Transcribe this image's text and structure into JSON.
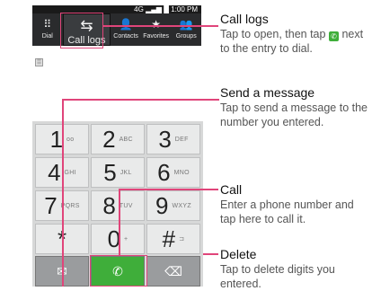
{
  "status": {
    "time": "1:00 PM",
    "signal_text": "4G"
  },
  "tabs": [
    {
      "label": "Dial",
      "icon": "dialpad-icon",
      "glyph": "⠿"
    },
    {
      "label": "Call logs",
      "icon": "call-logs-icon",
      "glyph": "⇆",
      "active": true
    },
    {
      "label": "Contacts",
      "icon": "contacts-icon",
      "glyph": "👤"
    },
    {
      "label": "Favorites",
      "icon": "star-icon",
      "glyph": "★"
    },
    {
      "label": "Groups",
      "icon": "groups-icon",
      "glyph": "👥"
    }
  ],
  "keys": [
    {
      "digit": "1",
      "sub": "oo"
    },
    {
      "digit": "2",
      "sub": "ABC"
    },
    {
      "digit": "3",
      "sub": "DEF"
    },
    {
      "digit": "4",
      "sub": "GHI"
    },
    {
      "digit": "5",
      "sub": "JKL"
    },
    {
      "digit": "6",
      "sub": "MNO"
    },
    {
      "digit": "7",
      "sub": "PQRS"
    },
    {
      "digit": "8",
      "sub": "TUV"
    },
    {
      "digit": "9",
      "sub": "WXYZ"
    },
    {
      "digit": "*",
      "sub": ""
    },
    {
      "digit": "0",
      "sub": "+"
    },
    {
      "digit": "#",
      "sub": "⊐"
    }
  ],
  "actions": {
    "message_glyph": "✉",
    "call_glyph": "✆",
    "delete_glyph": "⌫"
  },
  "callouts": {
    "call_logs": {
      "title": "Call logs",
      "desc_before": "Tap to open, then tap",
      "desc_after": "next to the entry to dial."
    },
    "send_message": {
      "title": "Send a message",
      "desc": "Tap to send a message to the number you entered."
    },
    "call": {
      "title": "Call",
      "desc": "Enter a phone number and tap here to call it."
    },
    "delete": {
      "title": "Delete",
      "desc": "Tap to delete digits you entered."
    }
  },
  "colors": {
    "accent": "#e0457a",
    "call_green": "#3fae3a",
    "tab_bg": "#2a2b2d"
  }
}
